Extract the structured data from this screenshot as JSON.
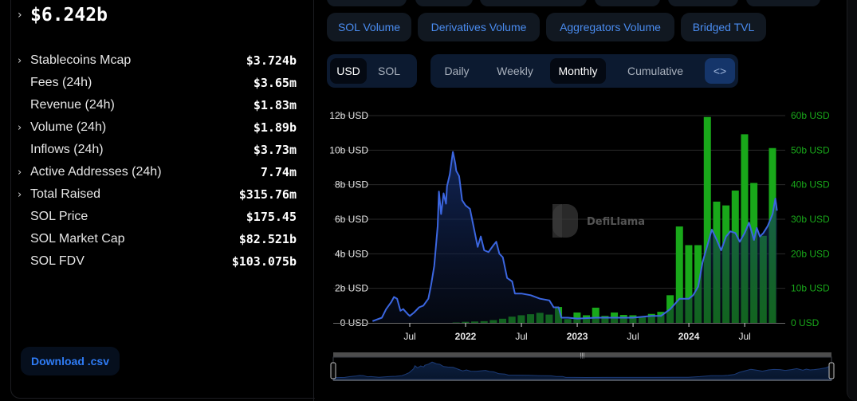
{
  "summary": {
    "tvl_value": "$6.242b",
    "stats": [
      {
        "label": "Stablecoins Mcap",
        "value": "$3.724b",
        "expandable": true
      },
      {
        "label": "Fees (24h)",
        "value": "$3.65m",
        "expandable": false
      },
      {
        "label": "Revenue (24h)",
        "value": "$1.83m",
        "expandable": false
      },
      {
        "label": "Volume (24h)",
        "value": "$1.89b",
        "expandable": true
      },
      {
        "label": "Inflows (24h)",
        "value": "$3.73m",
        "expandable": false
      },
      {
        "label": "Active Addresses (24h)",
        "value": "7.74m",
        "expandable": true
      },
      {
        "label": "Total Raised",
        "value": "$315.76m",
        "expandable": true
      },
      {
        "label": "SOL Price",
        "value": "$175.45",
        "expandable": false
      },
      {
        "label": "SOL Market Cap",
        "value": "$82.521b",
        "expandable": false
      },
      {
        "label": "SOL FDV",
        "value": "$103.075b",
        "expandable": false
      }
    ],
    "download_label": "Download .csv"
  },
  "metric_chips": [
    {
      "label": "SOL Volume"
    },
    {
      "label": "Derivatives Volume"
    },
    {
      "label": "Aggregators Volume"
    },
    {
      "label": "Bridged TVL"
    }
  ],
  "denomination": {
    "options": [
      "USD",
      "SOL"
    ],
    "selected": "USD"
  },
  "period": {
    "options": [
      "Daily",
      "Weekly",
      "Monthly",
      "Cumulative"
    ],
    "selected": "Monthly",
    "embed_icon": "code-icon",
    "embed_glyph": "<>"
  },
  "watermark": "DefiLlama",
  "colors": {
    "tvl_line": "#3b66e0",
    "volume_bars": "#19a81a",
    "accent": "#2f7cf6"
  },
  "chart_data": {
    "type": "bar+area",
    "title": "",
    "x_ticks": [
      {
        "label": "Jul",
        "date": "2021-07",
        "bold": false
      },
      {
        "label": "2022",
        "date": "2022-01",
        "bold": true
      },
      {
        "label": "Jul",
        "date": "2022-07",
        "bold": false
      },
      {
        "label": "2023",
        "date": "2023-01",
        "bold": true
      },
      {
        "label": "Jul",
        "date": "2023-07",
        "bold": false
      },
      {
        "label": "2024",
        "date": "2024-01",
        "bold": true
      },
      {
        "label": "Jul",
        "date": "2024-07",
        "bold": false
      }
    ],
    "x_range": [
      "2021-03",
      "2024-10"
    ],
    "left_axis": {
      "unit": "USD",
      "ticks": [
        "0 USD",
        "2b USD",
        "4b USD",
        "6b USD",
        "8b USD",
        "10b USD",
        "12b USD"
      ],
      "range": [
        0,
        12
      ]
    },
    "right_axis": {
      "unit": "USD",
      "ticks": [
        "0 USD",
        "10b USD",
        "20b USD",
        "30b USD",
        "40b USD",
        "50b USD",
        "60b USD"
      ],
      "range": [
        0,
        60
      ]
    },
    "grid": true,
    "series": [
      {
        "name": "TVL",
        "type": "area",
        "axis": "left",
        "unit": "billion USD",
        "points": [
          [
            "2021-03",
            0.1
          ],
          [
            "2021-04",
            0.3
          ],
          [
            "2021-04-15",
            0.8
          ],
          [
            "2021-05",
            1.2
          ],
          [
            "2021-05-10",
            1.5
          ],
          [
            "2021-05-20",
            1.4
          ],
          [
            "2021-06",
            0.7
          ],
          [
            "2021-06-10",
            0.8
          ],
          [
            "2021-06-25",
            0.5
          ],
          [
            "2021-07",
            0.4
          ],
          [
            "2021-07-15",
            0.6
          ],
          [
            "2021-08",
            0.9
          ],
          [
            "2021-08-15",
            1.0
          ],
          [
            "2021-09",
            1.4
          ],
          [
            "2021-09-10",
            2.2
          ],
          [
            "2021-09-20",
            3.3
          ],
          [
            "2021-10",
            5.6
          ],
          [
            "2021-10-05",
            7.6
          ],
          [
            "2021-10-12",
            6.3
          ],
          [
            "2021-10-20",
            7.5
          ],
          [
            "2021-10-28",
            6.9
          ],
          [
            "2021-11",
            7.9
          ],
          [
            "2021-11-10",
            8.6
          ],
          [
            "2021-11-20",
            9.9
          ],
          [
            "2021-11-28",
            9.2
          ],
          [
            "2021-12",
            8.8
          ],
          [
            "2021-12-10",
            8.5
          ],
          [
            "2021-12-20",
            7.1
          ],
          [
            "2022-01",
            6.8
          ],
          [
            "2022-01-15",
            6.6
          ],
          [
            "2022-02",
            5.2
          ],
          [
            "2022-02-10",
            4.4
          ],
          [
            "2022-02-20",
            5.0
          ],
          [
            "2022-03",
            4.2
          ],
          [
            "2022-03-15",
            4.1
          ],
          [
            "2022-04",
            4.5
          ],
          [
            "2022-04-10",
            4.7
          ],
          [
            "2022-04-20",
            4.0
          ],
          [
            "2022-05",
            3.8
          ],
          [
            "2022-05-15",
            2.6
          ],
          [
            "2022-06",
            2.4
          ],
          [
            "2022-06-10",
            1.7
          ],
          [
            "2022-07",
            1.7
          ],
          [
            "2022-08",
            1.6
          ],
          [
            "2022-09",
            1.4
          ],
          [
            "2022-10",
            1.3
          ],
          [
            "2022-10-15",
            0.9
          ],
          [
            "2022-11",
            0.9
          ],
          [
            "2022-11-10",
            0.3
          ],
          [
            "2022-12",
            0.3
          ],
          [
            "2023-01",
            0.25
          ],
          [
            "2023-03",
            0.3
          ],
          [
            "2023-05",
            0.3
          ],
          [
            "2023-07",
            0.3
          ],
          [
            "2023-09",
            0.4
          ],
          [
            "2023-10",
            0.4
          ],
          [
            "2023-11",
            0.8
          ],
          [
            "2023-12",
            1.4
          ],
          [
            "2024-01",
            1.4
          ],
          [
            "2024-01-15",
            1.6
          ],
          [
            "2024-02",
            2.1
          ],
          [
            "2024-02-15",
            3.5
          ],
          [
            "2024-03",
            4.5
          ],
          [
            "2024-03-15",
            5.4
          ],
          [
            "2024-04",
            4.8
          ],
          [
            "2024-04-15",
            4.2
          ],
          [
            "2024-05",
            5.0
          ],
          [
            "2024-05-15",
            5.3
          ],
          [
            "2024-06",
            5.2
          ],
          [
            "2024-06-15",
            4.7
          ],
          [
            "2024-07",
            5.2
          ],
          [
            "2024-07-15",
            5.8
          ],
          [
            "2024-08",
            4.8
          ],
          [
            "2024-08-10",
            5.5
          ],
          [
            "2024-08-20",
            5.0
          ],
          [
            "2024-09",
            5.2
          ],
          [
            "2024-09-15",
            5.6
          ],
          [
            "2024-10",
            6.3
          ],
          [
            "2024-10-10",
            7.2
          ],
          [
            "2024-10-15",
            6.5
          ]
        ]
      },
      {
        "name": "Volume",
        "type": "bar",
        "axis": "right",
        "unit": "billion USD",
        "points": [
          [
            "2021-12",
            0.1
          ],
          [
            "2022-01",
            0.3
          ],
          [
            "2022-02",
            0.4
          ],
          [
            "2022-03",
            0.5
          ],
          [
            "2022-04",
            0.8
          ],
          [
            "2022-05",
            1.2
          ],
          [
            "2022-06",
            1.8
          ],
          [
            "2022-07",
            2.2
          ],
          [
            "2022-08",
            2.5
          ],
          [
            "2022-09",
            2.9
          ],
          [
            "2022-10",
            2.4
          ],
          [
            "2022-11",
            4.6
          ],
          [
            "2022-12",
            1.1
          ],
          [
            "2023-01",
            3.0
          ],
          [
            "2023-02",
            2.2
          ],
          [
            "2023-03",
            4.4
          ],
          [
            "2023-04",
            2.0
          ],
          [
            "2023-05",
            3.0
          ],
          [
            "2023-06",
            2.3
          ],
          [
            "2023-07",
            2.2
          ],
          [
            "2023-08",
            1.6
          ],
          [
            "2023-09",
            2.6
          ],
          [
            "2023-10",
            3.2
          ],
          [
            "2023-11",
            8.0
          ],
          [
            "2023-12",
            27.9
          ],
          [
            "2024-01",
            22.5
          ],
          [
            "2024-02",
            22.5
          ],
          [
            "2024-03",
            59.6
          ],
          [
            "2024-04",
            35.1
          ],
          [
            "2024-05",
            34.0
          ],
          [
            "2024-06",
            38.3
          ],
          [
            "2024-07",
            54.6
          ],
          [
            "2024-08",
            40.5
          ],
          [
            "2024-09",
            25.2
          ],
          [
            "2024-10",
            50.6
          ]
        ]
      }
    ],
    "brush": {
      "start_fraction": 0.0,
      "end_fraction": 1.0
    }
  }
}
